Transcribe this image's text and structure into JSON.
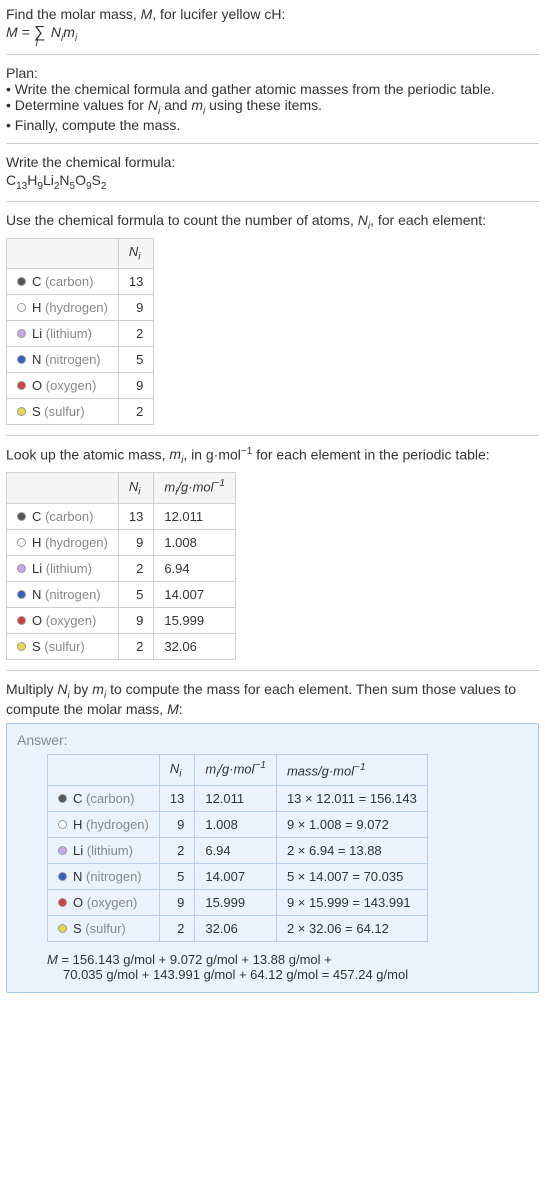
{
  "intro": {
    "line1_a": "Find the molar mass, ",
    "line1_b": "M",
    "line1_c": ", for lucifer yellow cH:",
    "formula_lhs": "M = ",
    "formula_sum": "∑",
    "formula_sub": "i",
    "formula_rhs_a": " N",
    "formula_rhs_b": "i",
    "formula_rhs_c": "m",
    "formula_rhs_d": "i"
  },
  "plan": {
    "title": "Plan:",
    "items": [
      "• Write the chemical formula and gather atomic masses from the periodic table.",
      "• Determine values for Nᵢ and mᵢ using these items.",
      "• Finally, compute the mass."
    ]
  },
  "chem_formula": {
    "title": "Write the chemical formula:",
    "parts": [
      "C",
      "13",
      "H",
      "9",
      "Li",
      "2",
      "N",
      "5",
      "O",
      "9",
      "S",
      "2"
    ]
  },
  "count_section": {
    "title_a": "Use the chemical formula to count the number of atoms, ",
    "title_b": "N",
    "title_c": "i",
    "title_d": ", for each element:",
    "header_Ni_a": "N",
    "header_Ni_b": "i"
  },
  "elements": [
    {
      "sym": "C",
      "name": "(carbon)",
      "N": "13",
      "m": "12.011",
      "mass": "13 × 12.011 = 156.143"
    },
    {
      "sym": "H",
      "name": "(hydrogen)",
      "N": "9",
      "m": "1.008",
      "mass": "9 × 1.008 = 9.072"
    },
    {
      "sym": "Li",
      "name": "(lithium)",
      "N": "2",
      "m": "6.94",
      "mass": "2 × 6.94 = 13.88"
    },
    {
      "sym": "N",
      "name": "(nitrogen)",
      "N": "5",
      "m": "14.007",
      "mass": "5 × 14.007 = 70.035"
    },
    {
      "sym": "O",
      "name": "(oxygen)",
      "N": "9",
      "m": "15.999",
      "mass": "9 × 15.999 = 143.991"
    },
    {
      "sym": "S",
      "name": "(sulfur)",
      "N": "2",
      "m": "32.06",
      "mass": "2 × 32.06 = 64.12"
    }
  ],
  "lookup_section": {
    "title_a": "Look up the atomic mass, ",
    "title_b": "m",
    "title_c": "i",
    "title_d": ", in g·mol",
    "title_e": "−1",
    "title_f": " for each element in the periodic table:",
    "header_mi_a": "m",
    "header_mi_b": "i",
    "header_mi_c": "/g·mol",
    "header_mi_d": "−1"
  },
  "multiply_section": {
    "line1_a": "Multiply ",
    "line1_b": "N",
    "line1_c": "i",
    "line1_d": " by ",
    "line1_e": "m",
    "line1_f": "i",
    "line1_g": " to compute the mass for each element. Then sum those values to compute the molar mass, ",
    "line1_h": "M",
    "line1_i": ":"
  },
  "answer": {
    "label": "Answer:",
    "header_mass_a": "mass/g·mol",
    "header_mass_b": "−1",
    "final_line1": "M = 156.143 g/mol + 9.072 g/mol + 13.88 g/mol +",
    "final_line2": "70.035 g/mol + 143.991 g/mol + 64.12 g/mol = 457.24 g/mol"
  }
}
